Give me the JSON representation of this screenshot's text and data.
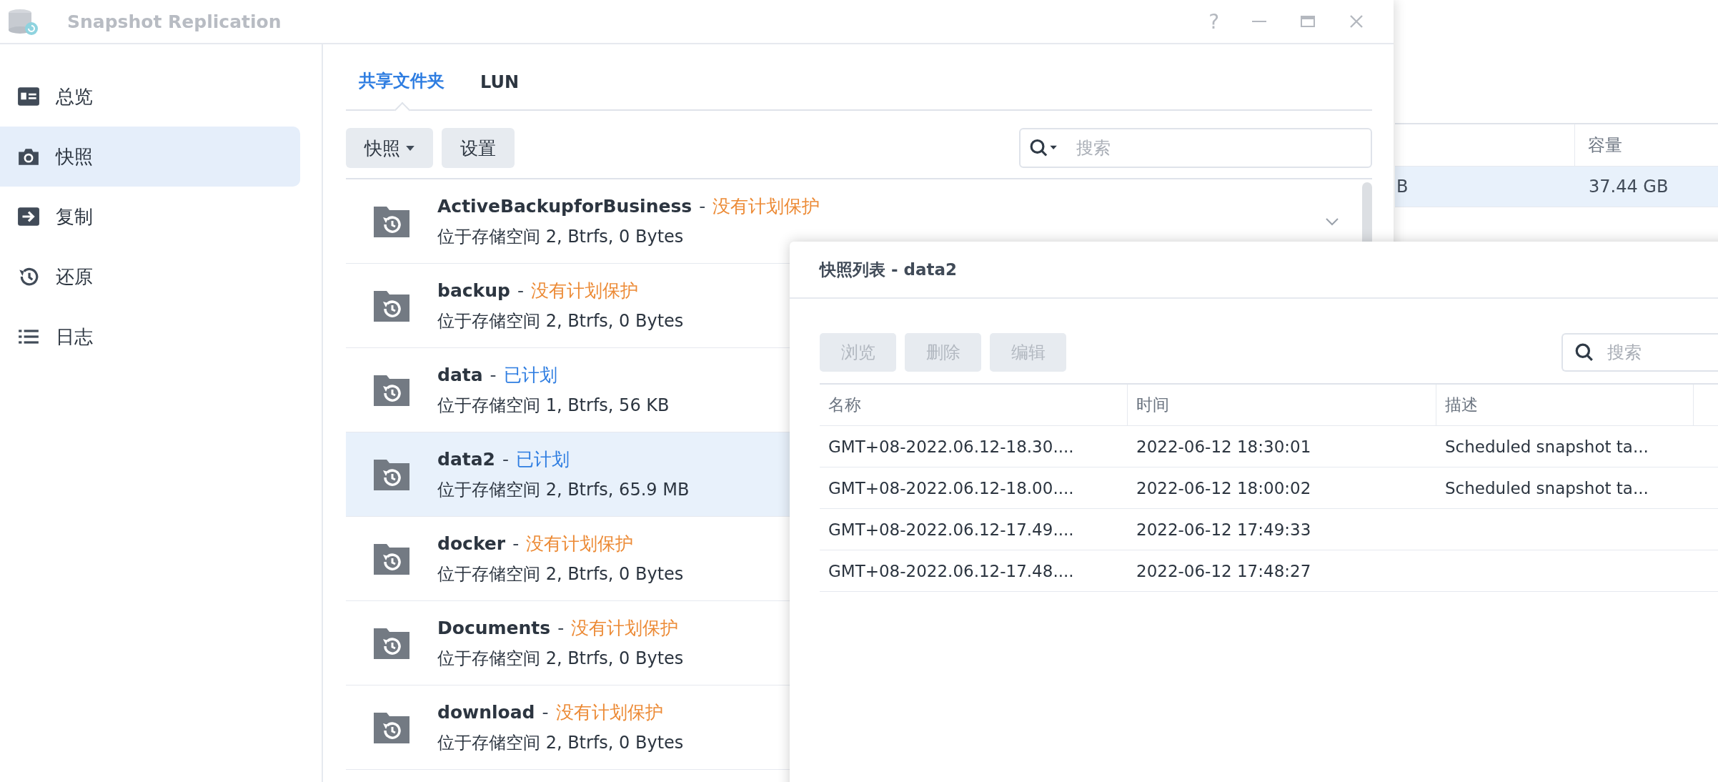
{
  "window": {
    "title": "Snapshot Replication",
    "help": "?"
  },
  "sidebar": {
    "items": [
      {
        "label": "总览",
        "kind": "overview",
        "selected": false
      },
      {
        "label": "快照",
        "kind": "camera",
        "selected": true
      },
      {
        "label": "复制",
        "kind": "replicate",
        "selected": false
      },
      {
        "label": "还原",
        "kind": "restore",
        "selected": false
      },
      {
        "label": "日志",
        "kind": "log",
        "selected": false
      }
    ]
  },
  "tabs": [
    {
      "label": "共享文件夹",
      "selected": true
    },
    {
      "label": "LUN",
      "selected": false
    }
  ],
  "toolbar": {
    "buttons": [
      {
        "label": "快照",
        "kind": "dropdown"
      },
      {
        "label": "设置",
        "kind": "plain"
      }
    ],
    "search": {
      "placeholder": "搜索"
    }
  },
  "folders": [
    {
      "name": "ActiveBackupforBusiness",
      "separator": "-",
      "status": "没有计划保护",
      "scheduled": false,
      "detail": "位于存储空间 2, Btrfs, 0 Bytes",
      "selected": false,
      "expander": true
    },
    {
      "name": "backup",
      "separator": "-",
      "status": "没有计划保护",
      "scheduled": false,
      "detail": "位于存储空间 2, Btrfs, 0 Bytes",
      "selected": false,
      "expander": false
    },
    {
      "name": "data",
      "separator": "-",
      "status": "已计划",
      "scheduled": true,
      "detail": "位于存储空间 1, Btrfs, 56 KB",
      "selected": false,
      "expander": false
    },
    {
      "name": "data2",
      "separator": "-",
      "status": "已计划",
      "scheduled": true,
      "detail": "位于存储空间 2, Btrfs, 65.9 MB",
      "selected": true,
      "expander": false
    },
    {
      "name": "docker",
      "separator": "-",
      "status": "没有计划保护",
      "scheduled": false,
      "detail": "位于存储空间 2, Btrfs, 0 Bytes",
      "selected": false,
      "expander": false
    },
    {
      "name": "Documents",
      "separator": "-",
      "status": "没有计划保护",
      "scheduled": false,
      "detail": "位于存储空间 2, Btrfs, 0 Bytes",
      "selected": false,
      "expander": false
    },
    {
      "name": "download",
      "separator": "-",
      "status": "没有计划保护",
      "scheduled": false,
      "detail": "位于存储空间 2, Btrfs, 0 Bytes",
      "selected": false,
      "expander": false
    }
  ],
  "background_window": {
    "table": {
      "columns": [
        "容量"
      ],
      "rows": [
        {
          "column_1": "B",
          "capacity": "37.44 GB",
          "selected": true
        }
      ]
    }
  },
  "dialog": {
    "title": "快照列表 - data2",
    "buttons": [
      {
        "label": "浏览",
        "disabled": true
      },
      {
        "label": "删除",
        "disabled": true
      },
      {
        "label": "编辑",
        "disabled": true
      }
    ],
    "search": {
      "placeholder": "搜索"
    },
    "table": {
      "columns": [
        "名称",
        "时间",
        "描述"
      ],
      "rows": [
        {
          "name": "GMT+08-2022.06.12-18.30....",
          "time": "2022-06-12 18:30:01",
          "description": "Scheduled snapshot ta...",
          "selected": false
        },
        {
          "name": "GMT+08-2022.06.12-18.00....",
          "time": "2022-06-12 18:00:02",
          "description": "Scheduled snapshot ta...",
          "selected": false
        },
        {
          "name": "GMT+08-2022.06.12-17.49....",
          "time": "2022-06-12 17:49:33",
          "selected": false
        },
        {
          "name": "GMT+08-2022.06.12-17.48....",
          "time": "2022-06-12 17:48:27",
          "selected": false
        }
      ]
    }
  }
}
